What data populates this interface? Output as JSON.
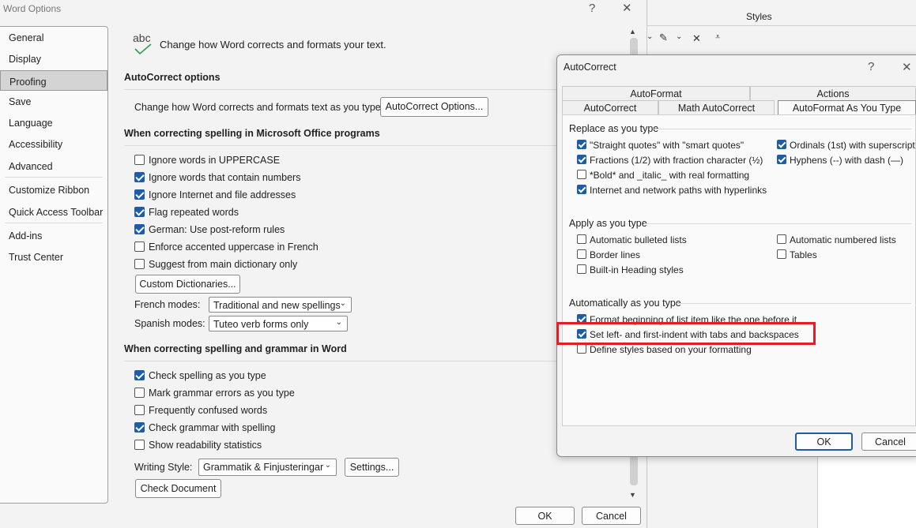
{
  "word_options": {
    "title": "Word Options",
    "help": "?",
    "close": "✕",
    "nav": [
      "General",
      "Display",
      "Proofing",
      "Save",
      "Language",
      "Accessibility",
      "Advanced",
      "Customize Ribbon",
      "Quick Access Toolbar",
      "Add-ins",
      "Trust Center"
    ],
    "selected_nav": "Proofing",
    "header_icon_text": "abc",
    "header_text": "Change how Word corrects and formats your text.",
    "autocorrect_section": "AutoCorrect options",
    "autocorrect_desc": "Change how Word corrects and formats text as you type:",
    "autocorrect_button": "AutoCorrect Options...",
    "office_section": "When correcting spelling in Microsoft Office programs",
    "office_options": [
      {
        "label": "Ignore words in UPPERCASE",
        "checked": false
      },
      {
        "label": "Ignore words that contain numbers",
        "checked": true
      },
      {
        "label": "Ignore Internet and file addresses",
        "checked": true
      },
      {
        "label": "Flag repeated words",
        "checked": true
      },
      {
        "label": "German: Use post-reform rules",
        "checked": true
      },
      {
        "label": "Enforce accented uppercase in French",
        "checked": false
      },
      {
        "label": "Suggest from main dictionary only",
        "checked": false
      }
    ],
    "custom_dict_button": "Custom Dictionaries...",
    "french_modes_label": "French modes:",
    "french_modes_value": "Traditional and new spellings",
    "spanish_modes_label": "Spanish modes:",
    "spanish_modes_value": "Tuteo verb forms only",
    "word_section": "When correcting spelling and grammar in Word",
    "word_options": [
      {
        "label": "Check spelling as you type",
        "checked": true
      },
      {
        "label": "Mark grammar errors as you type",
        "checked": false
      },
      {
        "label": "Frequently confused words",
        "checked": false
      },
      {
        "label": "Check grammar with spelling",
        "checked": true
      },
      {
        "label": "Show readability statistics",
        "checked": false
      }
    ],
    "writing_style_label": "Writing Style:",
    "writing_style_value": "Grammatik & Finjusteringar",
    "settings_button": "Settings...",
    "check_document_button": "Check Document",
    "ok": "OK",
    "cancel": "Cancel"
  },
  "word_background": {
    "styles_label": "Styles"
  },
  "autocorrect": {
    "title": "AutoCorrect",
    "help": "?",
    "close": "✕",
    "tabs_row1": [
      "AutoFormat",
      "Actions"
    ],
    "tabs_row2": [
      "AutoCorrect",
      "Math AutoCorrect",
      "AutoFormat As You Type"
    ],
    "active_tab": "AutoFormat As You Type",
    "replace_group": "Replace as you type",
    "replace_left": [
      {
        "label": "\"Straight quotes\" with \"smart quotes\"",
        "checked": true
      },
      {
        "label": "Fractions (1/2) with fraction character (½)",
        "checked": true
      },
      {
        "label": "*Bold* and _italic_ with real formatting",
        "checked": false
      },
      {
        "label": "Internet and network paths with hyperlinks",
        "checked": true
      }
    ],
    "replace_right": [
      {
        "label": "Ordinals (1st) with superscript",
        "checked": true
      },
      {
        "label": "Hyphens (--) with dash (—)",
        "checked": true
      }
    ],
    "apply_group": "Apply as you type",
    "apply_left": [
      {
        "label": "Automatic bulleted lists",
        "checked": false
      },
      {
        "label": "Border lines",
        "checked": false
      },
      {
        "label": "Built-in Heading styles",
        "checked": false
      }
    ],
    "apply_right": [
      {
        "label": "Automatic numbered lists",
        "checked": false
      },
      {
        "label": "Tables",
        "checked": false
      }
    ],
    "auto_group": "Automatically as you type",
    "auto_options": [
      {
        "label": "Format beginning of list item like the one before it",
        "checked": true
      },
      {
        "label": "Set left- and first-indent with tabs and backspaces",
        "checked": true
      },
      {
        "label": "Define styles based on your formatting",
        "checked": false
      }
    ],
    "ok": "OK",
    "cancel": "Cancel",
    "highlight_color": "#e51e25",
    "accent_color": "#1d5ca8"
  }
}
